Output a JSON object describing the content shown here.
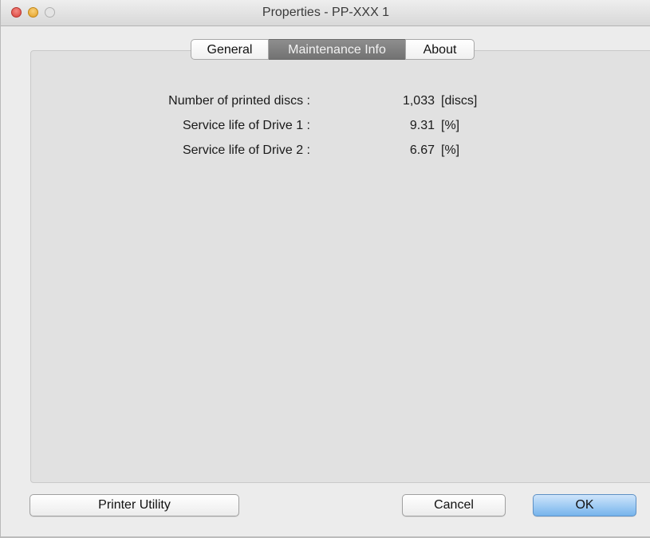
{
  "window": {
    "title": "Properties - PP-XXX 1"
  },
  "tabs": [
    {
      "label": "General",
      "selected": false
    },
    {
      "label": "Maintenance Info",
      "selected": true
    },
    {
      "label": "About",
      "selected": false
    }
  ],
  "maintenance": {
    "rows": [
      {
        "label": "Number of printed discs :",
        "value": "1,033",
        "unit": "[discs]"
      },
      {
        "label": "Service life of Drive 1 :",
        "value": "9.31",
        "unit": "[%]"
      },
      {
        "label": "Service life of Drive 2 :",
        "value": "6.67",
        "unit": "[%]"
      }
    ]
  },
  "buttons": {
    "printer_utility": "Printer Utility",
    "cancel": "Cancel",
    "ok": "OK"
  },
  "colors": {
    "ok_button": "#76b4ec",
    "selected_tab": "#7f7f7f",
    "close_light": "#d8423b",
    "minimize_light": "#e2a024"
  }
}
